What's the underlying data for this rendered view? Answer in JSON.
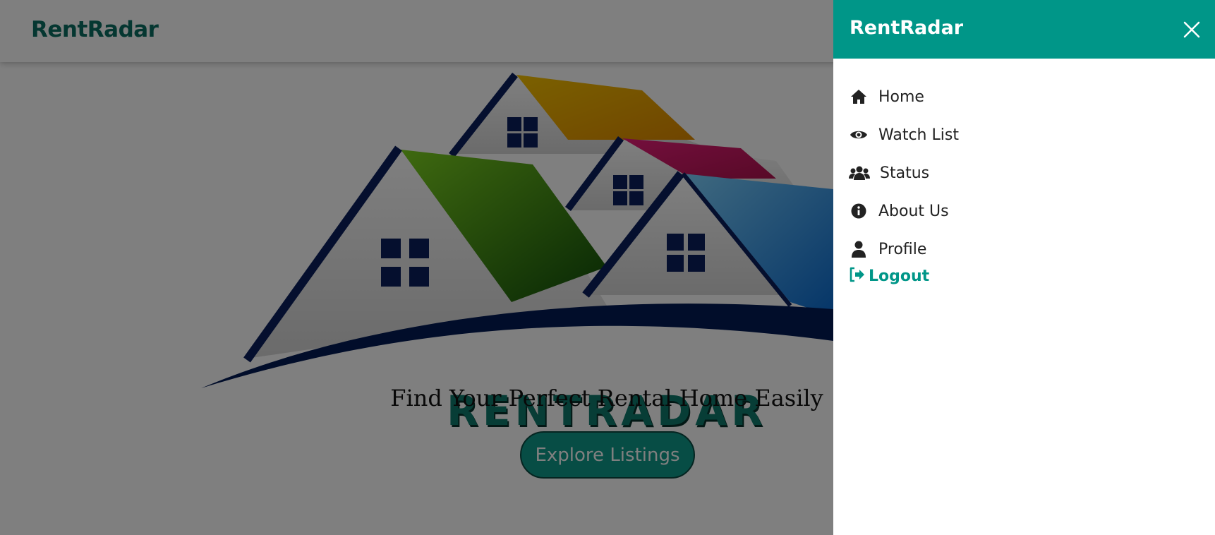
{
  "navbar": {
    "brand": "RentRadar"
  },
  "hero": {
    "logo_text": "RENTRADAR",
    "tagline": "Find Your Perfect Rental Home Easily",
    "explore_label": "Explore Listings"
  },
  "offcanvas": {
    "title": "RentRadar",
    "close_icon": "close-icon",
    "items": [
      {
        "label": "Home",
        "icon": "home-icon"
      },
      {
        "label": "Watch List",
        "icon": "eye-icon"
      },
      {
        "label": "Status",
        "icon": "users-icon"
      },
      {
        "label": "About Us",
        "icon": "info-icon"
      },
      {
        "label": "Profile",
        "icon": "user-icon"
      }
    ],
    "logout": {
      "label": "Logout",
      "icon": "sign-out-icon"
    }
  },
  "colors": {
    "brand": "#0b6e62",
    "accent": "#009688",
    "overlay": "rgba(0,0,0,0.5)"
  }
}
